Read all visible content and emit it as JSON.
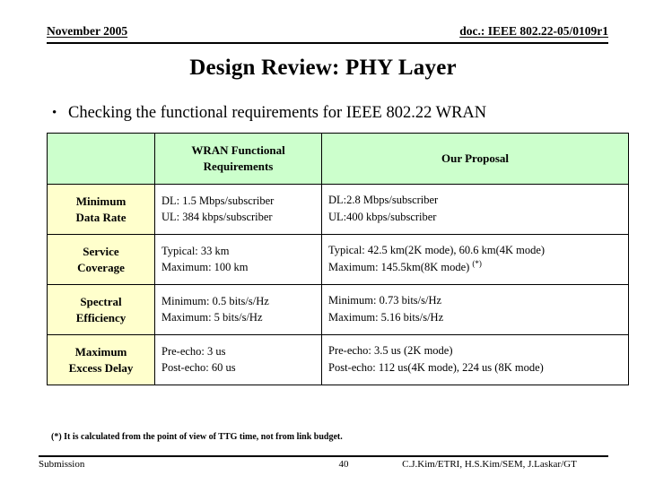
{
  "header": {
    "date": "November 2005",
    "doc": "doc.: IEEE 802.22-05/0109r1"
  },
  "title": "Design Review: PHY Layer",
  "bullet": {
    "marker": "•",
    "text": "Checking the functional requirements for IEEE 802.22 WRAN"
  },
  "table": {
    "columns": [
      {
        "label": ""
      },
      {
        "label": "WRAN Functional Requirements",
        "line1": "WRAN Functional",
        "line2": "Requirements"
      },
      {
        "label": "Our Proposal"
      }
    ],
    "rows": [
      {
        "label_line1": "Minimum",
        "label_line2": "Data Rate",
        "requirement_line1": "DL: 1.5 Mbps/subscriber",
        "requirement_line2": "UL: 384 kbps/subscriber",
        "proposal_line1": "DL:2.8 Mbps/subscriber",
        "proposal_line2": "UL:400 kbps/subscriber",
        "proposal_sup": ""
      },
      {
        "label_line1": "Service",
        "label_line2": "Coverage",
        "requirement_line1": "Typical: 33 km",
        "requirement_line2": "Maximum: 100 km",
        "proposal_line1": "Typical: 42.5 km(2K mode), 60.6 km(4K mode)",
        "proposal_line2": "Maximum: 145.5km(8K mode)",
        "proposal_sup": "(*)"
      },
      {
        "label_line1": "Spectral",
        "label_line2": "Efficiency",
        "requirement_line1": "Minimum: 0.5 bits/s/Hz",
        "requirement_line2": "Maximum: 5 bits/s/Hz",
        "proposal_line1": "Minimum: 0.73 bits/s/Hz",
        "proposal_line2": "Maximum: 5.16 bits/s/Hz",
        "proposal_sup": ""
      },
      {
        "label_line1": "Maximum",
        "label_line2": "Excess Delay",
        "requirement_line1": "Pre-echo: 3 us",
        "requirement_line2": "Post-echo: 60 us",
        "proposal_line1": "Pre-echo: 3.5 us (2K mode)",
        "proposal_line2": "Post-echo: 112 us(4K mode), 224 us (8K mode)",
        "proposal_sup": ""
      }
    ]
  },
  "footnote": "(*) It is calculated from the point of view of TTG time, not from link budget.",
  "footer": {
    "left": "Submission",
    "page": "40",
    "right": "C.J.Kim/ETRI, H.S.Kim/SEM, J.Laskar/GT"
  },
  "colors": {
    "header_row_bg": "#ccffcc",
    "label_col_bg": "#ffffcc",
    "border": "#000000",
    "text": "#000000"
  }
}
